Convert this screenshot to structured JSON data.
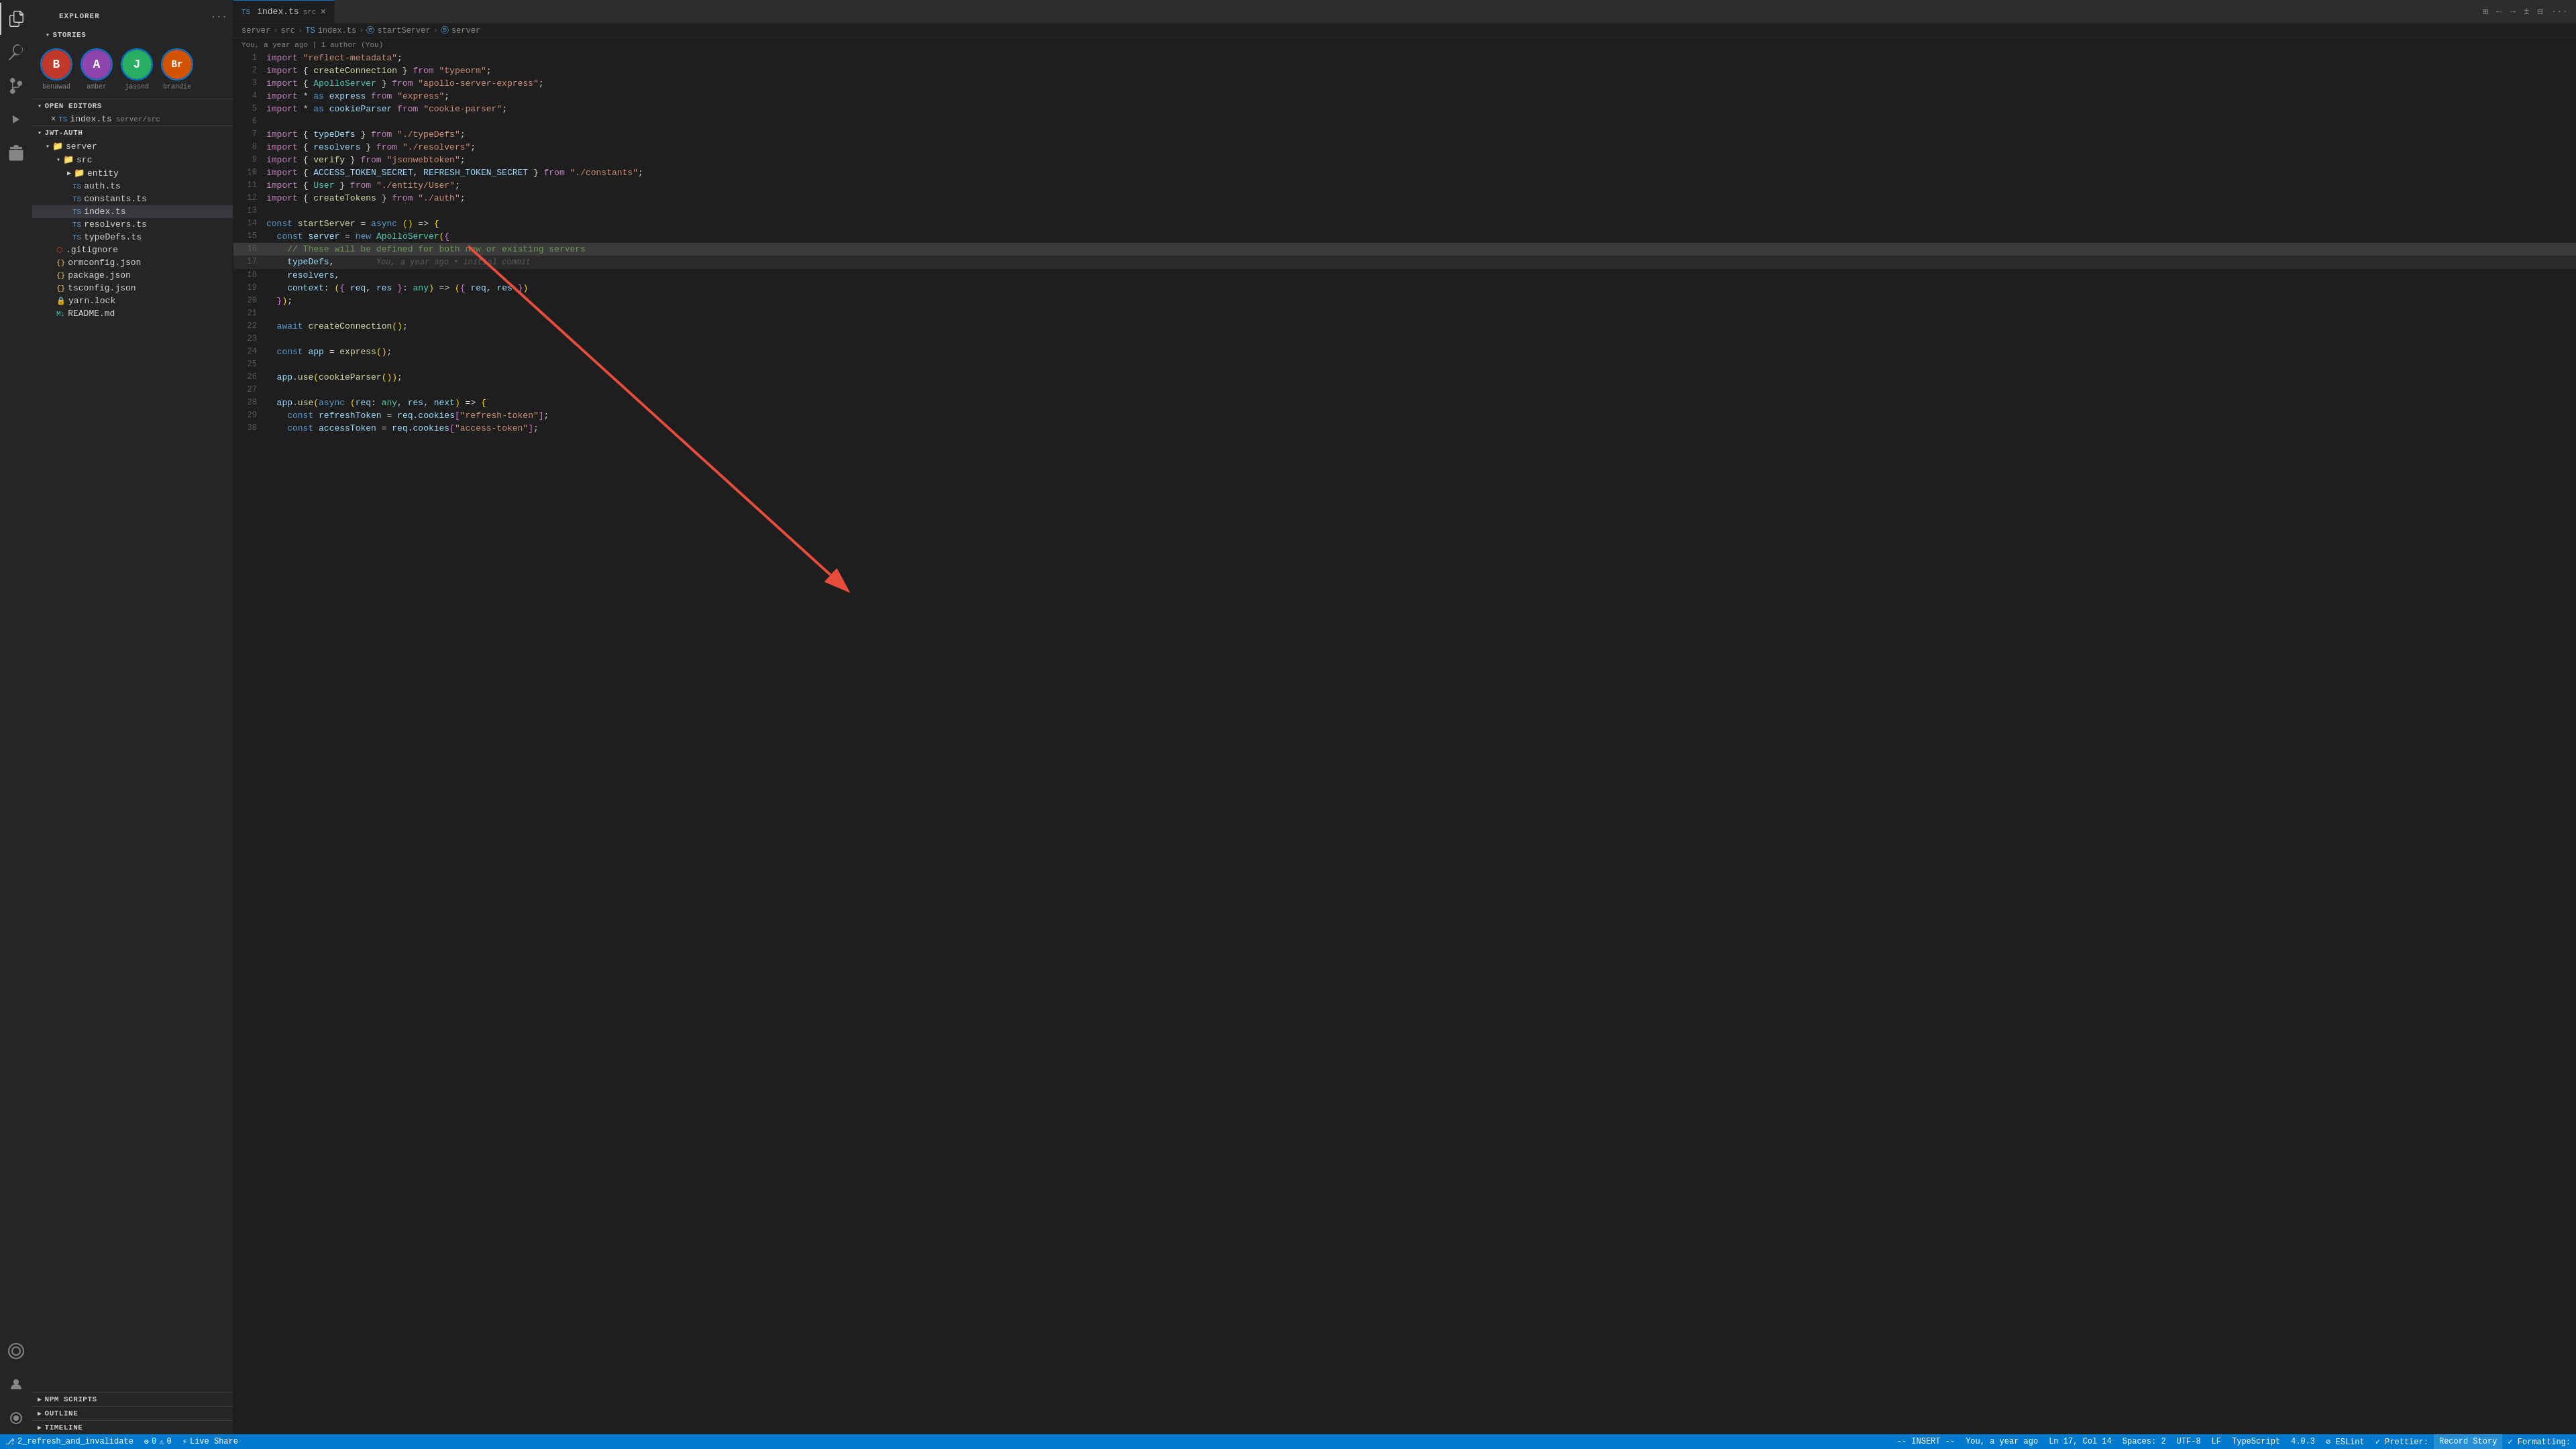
{
  "app": {
    "title": "EXPLORER",
    "title_options_label": "...",
    "tab_file": "index.ts",
    "tab_src_badge": "src",
    "tab_close": "×"
  },
  "breadcrumb": {
    "server": "server",
    "sep1": ">",
    "src": "src",
    "sep2": ">",
    "ts": "TS",
    "index_ts": "index.ts",
    "sep3": ">",
    "e1": "ⓔ",
    "startServer": "startServer",
    "sep4": ">",
    "e2": "ⓔ"
  },
  "blame": {
    "text": "You, a year ago | 1 author (You)"
  },
  "stories": {
    "header": "STORIES",
    "arrow": "▾",
    "avatars": [
      {
        "name": "benawad",
        "color": "#c0392b",
        "initial": "B"
      },
      {
        "name": "amber",
        "color": "#8e44ad",
        "initial": "A"
      },
      {
        "name": "jasond",
        "color": "#27ae60",
        "initial": "J"
      },
      {
        "name": "brandie",
        "color": "#d35400",
        "initial": "Br"
      }
    ]
  },
  "open_editors": {
    "header": "OPEN EDITORS",
    "arrow": "▾",
    "items": [
      {
        "close": "×",
        "icon": "TS",
        "name": "index.ts",
        "path": "server/src"
      }
    ]
  },
  "jwt_auth": {
    "root": "JWT-AUTH",
    "server": "server",
    "src": "src",
    "entity": "entity",
    "files": [
      {
        "icon": "TS",
        "name": "auth.ts"
      },
      {
        "icon": "TS",
        "name": "constants.ts"
      },
      {
        "icon": "TS",
        "name": "index.ts",
        "active": true
      },
      {
        "icon": "TS",
        "name": "resolvers.ts"
      },
      {
        "icon": "TS",
        "name": "typeDefs.ts"
      }
    ],
    "root_files": [
      {
        "icon": "GIT",
        "name": ".gitignore"
      },
      {
        "icon": "JSON",
        "name": "ormconfig.json"
      },
      {
        "icon": "JSON",
        "name": "package.json"
      },
      {
        "icon": "JSON",
        "name": "tsconfig.json"
      },
      {
        "icon": "GIT2",
        "name": "yarn.lock"
      },
      {
        "icon": "MD",
        "name": "README.md"
      }
    ]
  },
  "npm_scripts": {
    "header": "NPM SCRIPTS",
    "arrow": "▶"
  },
  "outline": {
    "header": "OUTLINE",
    "arrow": "▶"
  },
  "timeline": {
    "header": "TIMELINE",
    "arrow": "▶"
  },
  "code": {
    "lines": [
      {
        "num": 1,
        "html": "<span class='kw2'>import</span> <span class='str'>\"reflect-metadata\"</span><span>;</span>"
      },
      {
        "num": 2,
        "html": "<span class='kw2'>import</span> <span>{ </span><span class='fn'>createConnection</span><span> } </span><span class='kw2'>from</span> <span class='str'>\"typeorm\"</span><span>;</span>"
      },
      {
        "num": 3,
        "html": "<span class='kw2'>import</span> <span>{ </span><span class='type'>ApolloServer</span><span> } </span><span class='kw2'>from</span> <span class='str'>\"apollo-server-express\"</span><span>;</span>"
      },
      {
        "num": 4,
        "html": "<span class='kw2'>import</span> <span class='op'>*</span> <span class='kw'>as</span> <span class='var'>express</span> <span class='kw2'>from</span> <span class='str'>\"express\"</span><span>;</span>"
      },
      {
        "num": 5,
        "html": "<span class='kw2'>import</span> <span class='op'>*</span> <span class='kw'>as</span> <span class='var'>cookieParser</span> <span class='kw2'>from</span> <span class='str'>\"cookie-parser\"</span><span>;</span>"
      },
      {
        "num": 6,
        "html": ""
      },
      {
        "num": 7,
        "html": "<span class='kw2'>import</span> <span>{ </span><span class='var'>typeDefs</span><span> } </span><span class='kw2'>from</span> <span class='str'>\"./typeDefs\"</span><span>;</span>"
      },
      {
        "num": 8,
        "html": "<span class='kw2'>import</span> <span>{ </span><span class='var'>resolvers</span><span> } </span><span class='kw2'>from</span> <span class='str'>\"./resolvers\"</span><span>;</span>"
      },
      {
        "num": 9,
        "html": "<span class='kw2'>import</span> <span>{ </span><span class='fn'>verify</span><span> } </span><span class='kw2'>from</span> <span class='str'>\"jsonwebtoken\"</span><span>;</span>"
      },
      {
        "num": 10,
        "html": "<span class='kw2'>import</span> <span>{ </span><span class='var'>ACCESS_TOKEN_SECRET</span><span>, </span><span class='var'>REFRESH_TOKEN_SECRET</span><span> } </span><span class='kw2'>from</span> <span class='str'>\"./constants\"</span><span>;</span>"
      },
      {
        "num": 11,
        "html": "<span class='kw2'>import</span> <span>{ </span><span class='type'>User</span><span> } </span><span class='kw2'>from</span> <span class='str'>\"./entity/User\"</span><span>;</span>"
      },
      {
        "num": 12,
        "html": "<span class='kw2'>import</span> <span>{ </span><span class='fn'>createTokens</span><span> } </span><span class='kw2'>from</span> <span class='str'>\"./auth\"</span><span>;</span>"
      },
      {
        "num": 13,
        "html": ""
      },
      {
        "num": 14,
        "html": "<span class='kw'>const</span> <span class='fn'>startServer</span> <span>=</span> <span class='kw'>async</span> <span class='paren'>(</span><span class='paren'>)</span> <span>=></span> <span class='paren'>{</span>"
      },
      {
        "num": 15,
        "html": "  <span class='kw'>const</span> <span class='var'>server</span> <span>=</span> <span class='kw'>new</span> <span class='type'>ApolloServer</span><span class='paren'>(</span><span class='bracket'>{</span>"
      },
      {
        "num": 16,
        "html": "    <span class='comment'>// These will be defined for both new or existing servers</span>"
      },
      {
        "num": 17,
        "html": "    <span class='var'>typeDefs</span><span>,</span>",
        "blame": "You, a year ago • initial commit"
      },
      {
        "num": 18,
        "html": "    <span class='var'>resolvers</span><span>,</span>"
      },
      {
        "num": 19,
        "html": "    <span class='var'>context</span><span>: </span><span class='paren'>(</span><span class='bracket'>{</span> <span class='var'>req</span><span>, </span><span class='var'>res</span> <span class='bracket'>}</span><span>: </span><span class='type'>any</span><span class='paren'>)</span> <span>=></span> <span class='paren'>(</span><span class='bracket'>{</span> <span class='var'>req</span><span>, </span><span class='var'>res</span> <span class='bracket'>}</span><span class='paren'>)</span>"
      },
      {
        "num": 20,
        "html": "  <span class='bracket'>}</span><span class='paren'>)</span><span>;</span>"
      },
      {
        "num": 21,
        "html": ""
      },
      {
        "num": 22,
        "html": "  <span class='kw'>await</span> <span class='fn'>createConnection</span><span class='paren'>(</span><span class='paren'>)</span><span>;</span>"
      },
      {
        "num": 23,
        "html": ""
      },
      {
        "num": 24,
        "html": "  <span class='kw'>const</span> <span class='var'>app</span> <span>=</span> <span class='fn'>express</span><span class='paren'>(</span><span class='paren'>)</span><span>;</span>"
      },
      {
        "num": 25,
        "html": ""
      },
      {
        "num": 26,
        "html": "  <span class='var'>app</span><span>.</span><span class='fn'>use</span><span class='paren'>(</span><span class='fn'>cookieParser</span><span class='paren'>(</span><span class='paren'>)</span><span class='paren'>)</span><span>;</span>"
      },
      {
        "num": 27,
        "html": ""
      },
      {
        "num": 28,
        "html": "  <span class='var'>app</span><span>.</span><span class='fn'>use</span><span class='paren'>(</span><span class='kw'>async</span> <span class='paren'>(</span><span class='var'>req</span><span>: </span><span class='type'>any</span><span>, </span><span class='var'>res</span><span>, </span><span class='var'>next</span><span class='paren'>)</span> <span>=></span> <span class='paren'>{</span>"
      },
      {
        "num": 29,
        "html": "    <span class='kw'>const</span> <span class='var'>refreshToken</span> <span>=</span> <span class='var'>req</span><span>.</span><span class='var'>cookies</span><span class='bracket'>[</span><span class='str'>\"refresh-token\"</span><span class='bracket'>]</span><span>;</span>"
      },
      {
        "num": 30,
        "html": "    <span class='kw'>const</span> <span class='var'>accessToken</span> <span>=</span> <span class='var'>req</span><span>.</span><span class='var'>cookies</span><span class='bracket'>[</span><span class='str'>\"access-token\"</span><span class='bracket'>]</span><span>;</span>"
      }
    ]
  },
  "status_bar": {
    "branch": "2_refresh_and_invalidate",
    "branch_icon": "⎇",
    "errors": "0",
    "warnings": "0",
    "error_icon": "⊗",
    "warning_icon": "⚠",
    "live_share_icon": "⚡",
    "live_share": "Live Share",
    "mode": "-- INSERT --",
    "git_status": "You, a year ago",
    "line_col": "Ln 17, Col 14",
    "spaces": "Spaces: 2",
    "encoding": "UTF-8",
    "line_ending": "LF",
    "language": "TypeScript",
    "version": "4.0.3",
    "eslint": "⊘ ESLint",
    "prettier": "✓ Prettier:",
    "record_story": "Record Story",
    "formatting": "✓ Formatting:"
  }
}
